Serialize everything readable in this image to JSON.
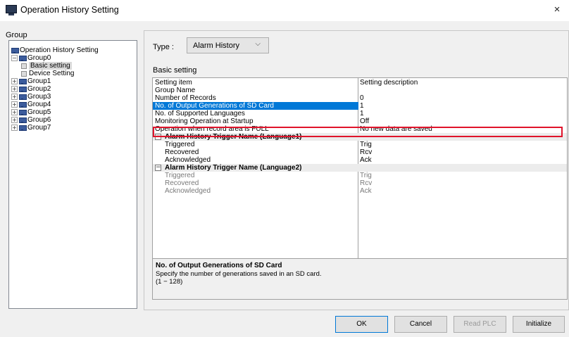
{
  "window": {
    "title": "Operation History Setting",
    "close_glyph": "×"
  },
  "group_panel": {
    "label": "Group",
    "tree": [
      {
        "label": "Operation History Setting",
        "icon": "group-icon",
        "toggle": ""
      },
      {
        "label": "Group0",
        "icon": "group-icon",
        "toggle": "−"
      },
      {
        "label": "Basic setting",
        "icon": "document-icon",
        "toggle": "",
        "selected": true
      },
      {
        "label": "Device Setting",
        "icon": "document-icon",
        "toggle": ""
      },
      {
        "label": "Group1",
        "icon": "group-icon",
        "toggle": "+"
      },
      {
        "label": "Group2",
        "icon": "group-icon",
        "toggle": "+"
      },
      {
        "label": "Group3",
        "icon": "group-icon",
        "toggle": "+"
      },
      {
        "label": "Group4",
        "icon": "group-icon",
        "toggle": "+"
      },
      {
        "label": "Group5",
        "icon": "group-icon",
        "toggle": "+"
      },
      {
        "label": "Group6",
        "icon": "group-icon",
        "toggle": "+"
      },
      {
        "label": "Group7",
        "icon": "group-icon",
        "toggle": "+"
      }
    ]
  },
  "type": {
    "label": "Type :",
    "value": "Alarm History",
    "chevron": "⌵"
  },
  "basic_setting": {
    "label": "Basic setting",
    "header": {
      "item": "Setting item",
      "description": "Setting description"
    },
    "rows": [
      {
        "item": "Group Name",
        "value": ""
      },
      {
        "item": "Number of Records",
        "value": "0"
      },
      {
        "item": "No. of Output Generations of SD Card",
        "value": "1",
        "selected": true
      },
      {
        "item": "No. of Supported Languages",
        "value": "1"
      },
      {
        "item": "Monitoring Operation at Startup",
        "value": "Off"
      },
      {
        "item": "Operation when record area is FULL",
        "value": "No new data are saved"
      }
    ],
    "section1": {
      "title": "Alarm History Trigger Name (Language1)",
      "rows": [
        {
          "item": "Triggered",
          "value": "Trig"
        },
        {
          "item": "Recovered",
          "value": "Rcv"
        },
        {
          "item": "Acknowledged",
          "value": "Ack"
        }
      ]
    },
    "section2": {
      "title": "Alarm History Trigger Name (Language2)",
      "rows": [
        {
          "item": "Triggered",
          "value": "Trig"
        },
        {
          "item": "Recovered",
          "value": "Rcv"
        },
        {
          "item": "Acknowledged",
          "value": "Ack"
        }
      ]
    }
  },
  "description": {
    "title": "No. of Output Generations of SD Card",
    "line1": "Specify the number of generations saved in an SD card.",
    "line2": "(1 − 128)"
  },
  "buttons": {
    "ok": "OK",
    "cancel": "Cancel",
    "read_plc": "Read PLC",
    "initialize": "Initialize"
  },
  "colors": {
    "selection": "#0078d7",
    "highlight_box": "#e0142b"
  }
}
